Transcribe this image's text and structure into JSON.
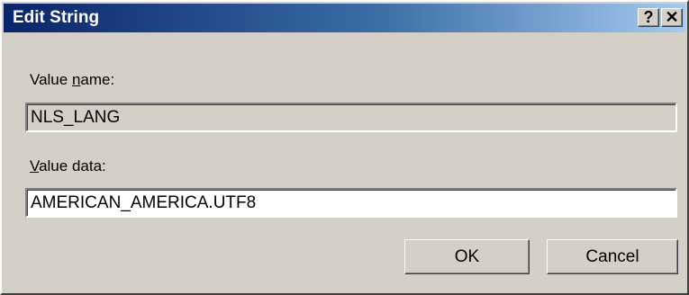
{
  "window": {
    "title": "Edit String",
    "help_label": "?",
    "close_label": "✕"
  },
  "value_name": {
    "label_prefix": "Value ",
    "label_accel": "n",
    "label_rest": "ame:",
    "value": "NLS_LANG"
  },
  "value_data": {
    "label_accel": "V",
    "label_rest": "alue data:",
    "value": "AMERICAN_AMERICA.UTF8"
  },
  "buttons": {
    "ok": "OK",
    "cancel": "Cancel"
  },
  "colors": {
    "titlebar_start": "#0a246a",
    "titlebar_end": "#a6caf0",
    "dialog_face": "#d4d0c8"
  }
}
